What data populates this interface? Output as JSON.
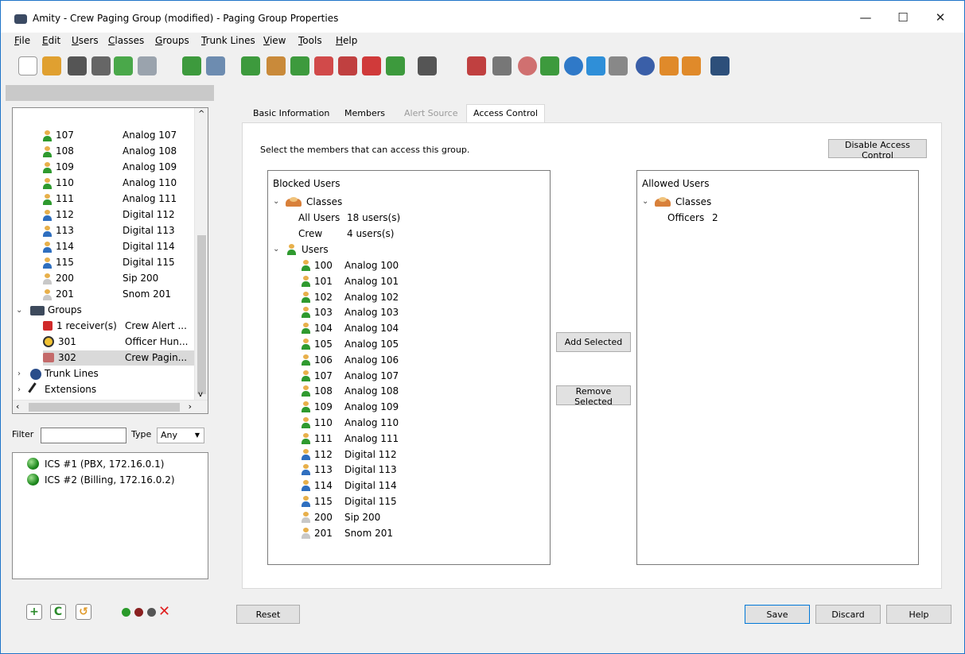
{
  "window": {
    "title": "Amity - Crew Paging Group (modified) - Paging Group Properties",
    "minimize": "—",
    "maximize": "☐",
    "close": "✕"
  },
  "menu": [
    "File",
    "Edit",
    "Users",
    "Classes",
    "Groups",
    "Trunk Lines",
    "View",
    "Tools",
    "Help"
  ],
  "tree": {
    "users": [
      {
        "num": "107",
        "name": "Analog 107",
        "kind": "analog"
      },
      {
        "num": "108",
        "name": "Analog 108",
        "kind": "analog"
      },
      {
        "num": "109",
        "name": "Analog 109",
        "kind": "analog"
      },
      {
        "num": "110",
        "name": "Analog 110",
        "kind": "analog"
      },
      {
        "num": "111",
        "name": "Analog 111",
        "kind": "analog"
      },
      {
        "num": "112",
        "name": "Digital 112",
        "kind": "digital"
      },
      {
        "num": "113",
        "name": "Digital 113",
        "kind": "digital"
      },
      {
        "num": "114",
        "name": "Digital 114",
        "kind": "digital"
      },
      {
        "num": "115",
        "name": "Digital 115",
        "kind": "digital"
      },
      {
        "num": "200",
        "name": "Sip 200",
        "kind": "sip"
      },
      {
        "num": "201",
        "name": "Snom 201",
        "kind": "sip"
      }
    ],
    "groups_label": "Groups",
    "groups": [
      {
        "num": "1 receiver(s)",
        "name": "Crew Alert ..."
      },
      {
        "num": "301",
        "name": "Officer Hun..."
      },
      {
        "num": "302",
        "name": "Crew Pagin..."
      }
    ],
    "trunk_lines_label": "Trunk Lines",
    "extensions_label": "Extensions"
  },
  "filter": {
    "label": "Filter",
    "value": "",
    "type_label": "Type",
    "type_value": "Any"
  },
  "servers": [
    "ICS #1 (PBX, 172.16.0.1)",
    "ICS #2 (Billing, 172.16.0.2)"
  ],
  "tabs": [
    {
      "label": "Basic Information",
      "state": "normal"
    },
    {
      "label": "Members",
      "state": "normal"
    },
    {
      "label": "Alert Source",
      "state": "disabled"
    },
    {
      "label": "Access Control",
      "state": "active"
    }
  ],
  "access": {
    "instruction": "Select the members that can access this group.",
    "disable_button": "Disable Access Control",
    "blocked_title": "Blocked Users",
    "allowed_title": "Allowed Users",
    "classes_label": "Classes",
    "users_label": "Users",
    "blocked_classes": [
      {
        "name": "All Users",
        "count": "18 users(s)"
      },
      {
        "name": "Crew",
        "count": "4 users(s)"
      }
    ],
    "blocked_users": [
      {
        "num": "100",
        "name": "Analog 100",
        "kind": "analog"
      },
      {
        "num": "101",
        "name": "Analog 101",
        "kind": "analog"
      },
      {
        "num": "102",
        "name": "Analog 102",
        "kind": "analog"
      },
      {
        "num": "103",
        "name": "Analog 103",
        "kind": "analog"
      },
      {
        "num": "104",
        "name": "Analog 104",
        "kind": "analog"
      },
      {
        "num": "105",
        "name": "Analog 105",
        "kind": "analog"
      },
      {
        "num": "106",
        "name": "Analog 106",
        "kind": "analog"
      },
      {
        "num": "107",
        "name": "Analog 107",
        "kind": "analog"
      },
      {
        "num": "108",
        "name": "Analog 108",
        "kind": "analog"
      },
      {
        "num": "109",
        "name": "Analog 109",
        "kind": "analog"
      },
      {
        "num": "110",
        "name": "Analog 110",
        "kind": "analog"
      },
      {
        "num": "111",
        "name": "Analog 111",
        "kind": "analog"
      },
      {
        "num": "112",
        "name": "Digital 112",
        "kind": "digital"
      },
      {
        "num": "113",
        "name": "Digital 113",
        "kind": "digital"
      },
      {
        "num": "114",
        "name": "Digital 114",
        "kind": "digital"
      },
      {
        "num": "115",
        "name": "Digital 115",
        "kind": "digital"
      },
      {
        "num": "200",
        "name": "Sip 200",
        "kind": "sip"
      },
      {
        "num": "201",
        "name": "Snom 201",
        "kind": "sip"
      }
    ],
    "allowed_classes": [
      {
        "name": "Officers",
        "count": "2"
      }
    ],
    "add_button": "Add Selected",
    "remove_button": "Remove Selected"
  },
  "footer": {
    "reset": "Reset",
    "save": "Save",
    "discard": "Discard",
    "help": "Help"
  },
  "colors": {
    "window_border": "#1e74c8",
    "analog_user": "#2f9a2f",
    "digital_user": "#2f6fbf",
    "status_green": "#1f8a1f"
  }
}
